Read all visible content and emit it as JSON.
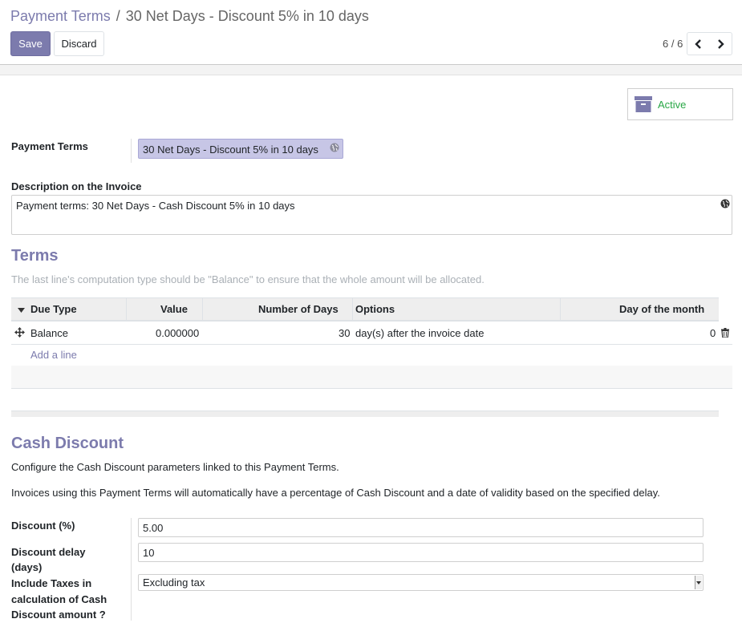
{
  "breadcrumb": {
    "parent": "Payment Terms",
    "separator": "/",
    "current": "30 Net Days - Discount 5% in 10 days"
  },
  "toolbar": {
    "save_label": "Save",
    "discard_label": "Discard"
  },
  "pager": {
    "value": "6 / 6"
  },
  "status_button": {
    "label": "Active"
  },
  "form": {
    "payment_terms_label": "Payment Terms",
    "payment_terms_value": "30 Net Days - Discount 5% in 10 days",
    "description_label": "Description on the Invoice",
    "description_value": "Payment terms: 30 Net Days - Cash Discount 5% in 10 days"
  },
  "terms": {
    "title": "Terms",
    "help": "The last line's computation type should be \"Balance\" to ensure that the whole amount will be allocated.",
    "columns": [
      "Due Type",
      "Value",
      "Number of Days",
      "Options",
      "Day of the month"
    ],
    "rows": [
      {
        "due_type": "Balance",
        "value": "0.000000",
        "days": "30",
        "options": "day(s) after the invoice date",
        "day_of_month": "0"
      }
    ],
    "add_line": "Add a line"
  },
  "cash_discount": {
    "title": "Cash Discount",
    "para1": "Configure the Cash Discount parameters linked to this Payment Terms.",
    "para2": "Invoices using this Payment Terms will automatically have a percentage of Cash Discount and a date of validity based on the specified delay.",
    "discount_label": "Discount (%)",
    "discount_value": "5.00",
    "delay_label_line1": "Discount delay",
    "delay_label_line2": "(days)",
    "delay_value": "10",
    "taxes_label_line1": "Include Taxes in",
    "taxes_label_line2": "calculation of Cash",
    "taxes_label_line3": "Discount amount ?",
    "taxes_value": "Excluding tax"
  },
  "colors": {
    "accent": "#7c7bad",
    "active_green": "#28a745",
    "field_highlight": "#c7c6e6"
  }
}
